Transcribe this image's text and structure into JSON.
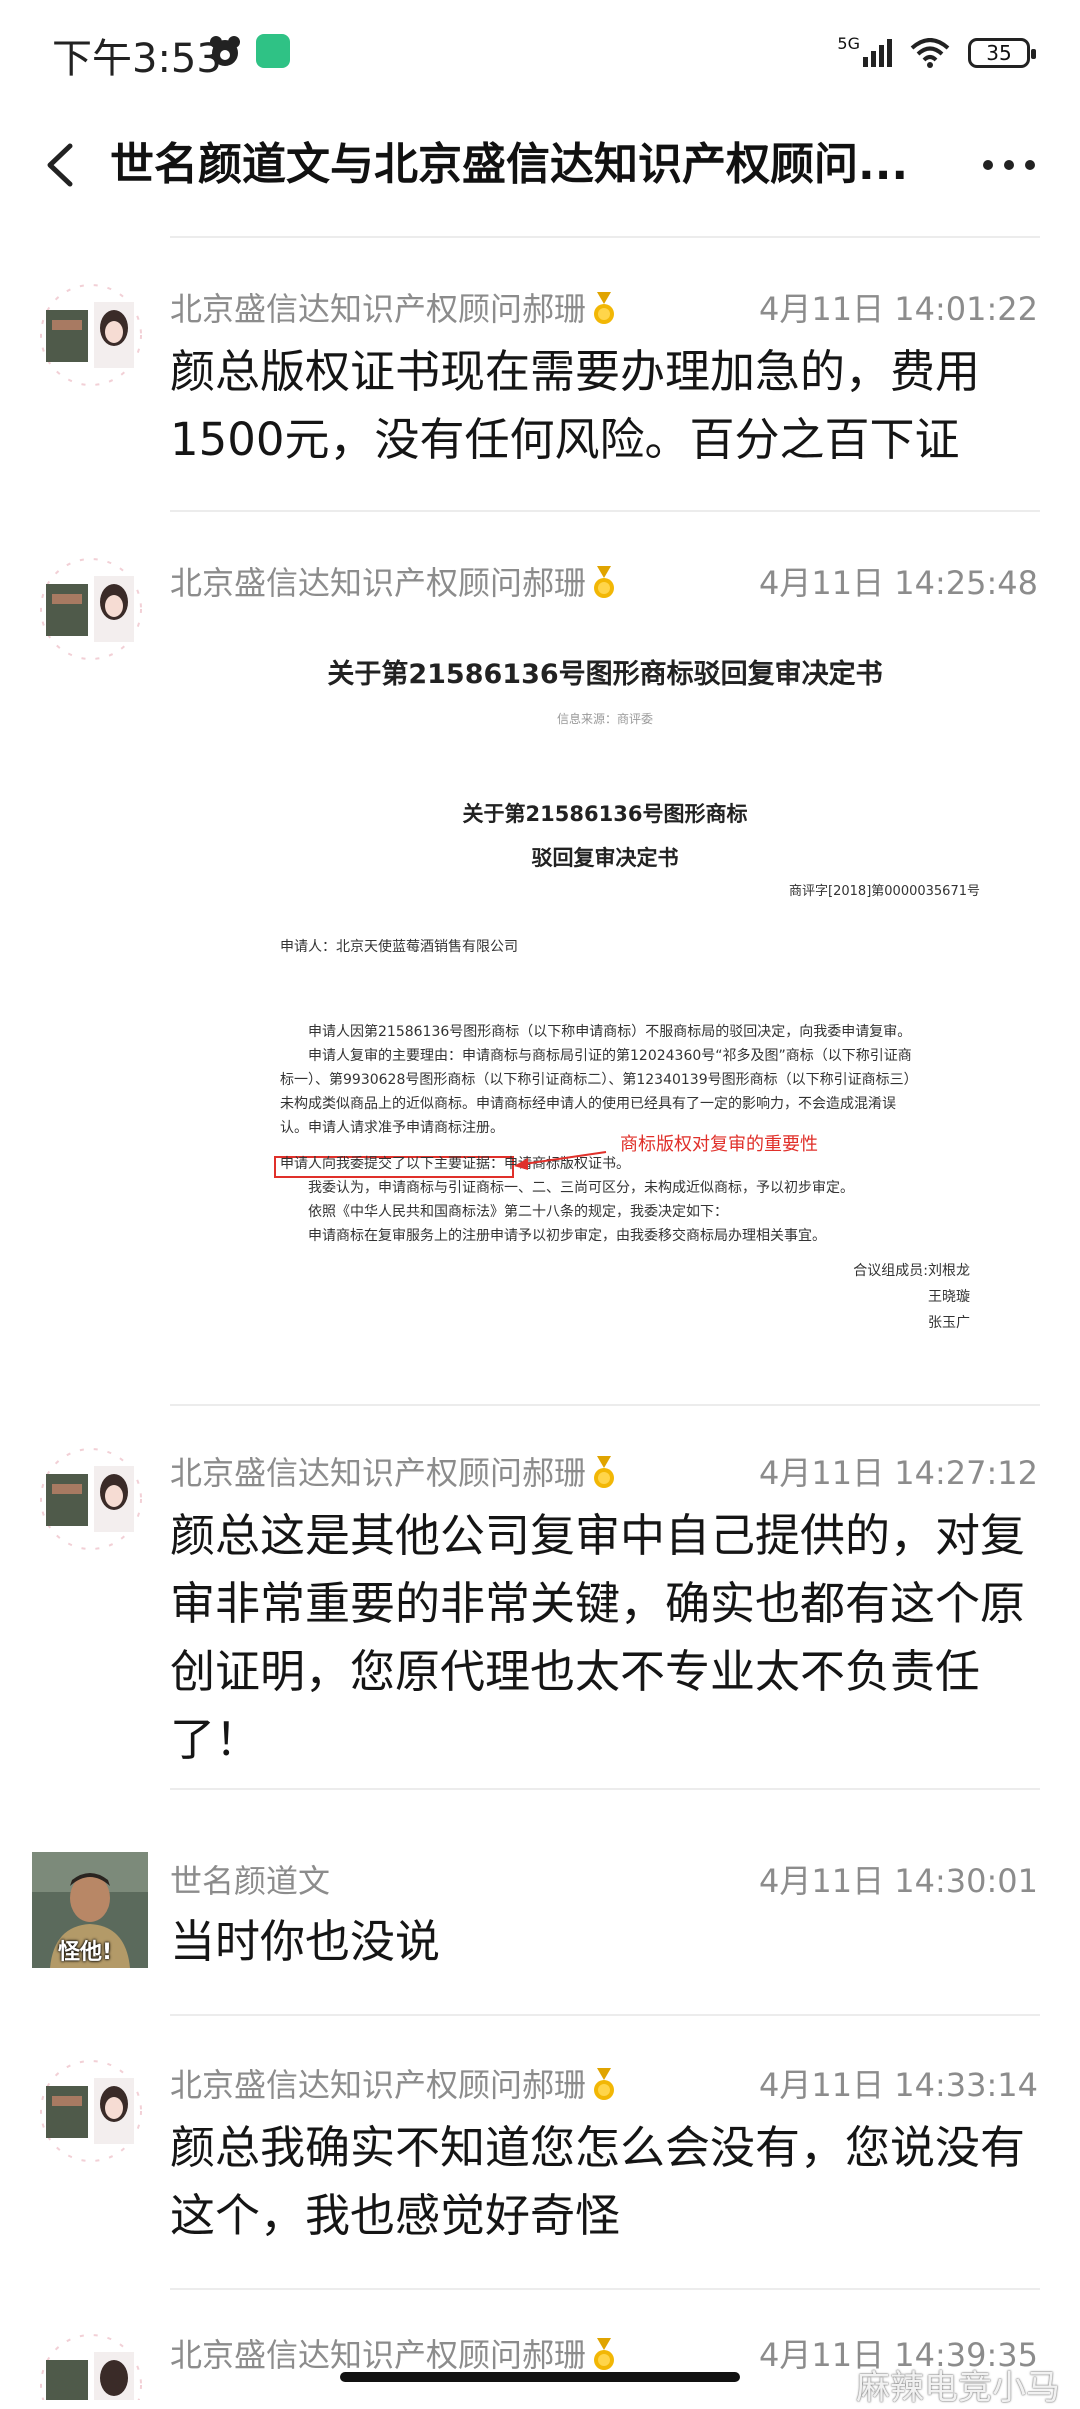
{
  "status_bar": {
    "time": "下午3:53",
    "network": "5G",
    "battery": "35"
  },
  "header": {
    "title": "世名颜道文与北京盛信达知识产权顾问..."
  },
  "messages": [
    {
      "sender": "北京盛信达知识产权顾问郝珊",
      "time": "4月11日 14:01:22",
      "text": "颜总版权证书现在需要办理加急的，费用1500元，没有任何风险。百分之百下证"
    },
    {
      "sender": "北京盛信达知识产权顾问郝珊",
      "time": "4月11日 14:25:48",
      "image": {
        "heading": "关于第21586136号图形商标驳回复审决定书",
        "source": "信息来源：商评委",
        "title_line1": "关于第21586136号图形商标",
        "title_line2": "驳回复审决定书",
        "ref": "商评字[2018]第0000035671号",
        "applicant": "申请人：北京天使蓝莓酒销售有限公司",
        "para1": "申请人因第21586136号图形商标（以下称申请商标）不服商标局的驳回决定，向我委申请复审。",
        "para2": "申请人复审的主要理由：申请商标与商标局引证的第12024360号“祁多及图”商标（以下称引证商标一）、第9930628号图形商标（以下称引证商标二）、第12340139号图形商标（以下称引证商标三）未构成类似商品上的近似商标。申请商标经申请人的使用已经具有了一定的影响力，不会造成混淆误认。申请人请求准予申请商标注册。",
        "para3": "申请人向我委提交了以下主要证据：申请商标版权证书。",
        "annotation": "商标版权对复审的重要性",
        "para4": "我委认为，申请商标与引证商标一、二、三尚可区分，未构成近似商标，予以初步审定。",
        "para5": "依照《中华人民共和国商标法》第二十八条的规定，我委决定如下：",
        "para6": "申请商标在复审服务上的注册申请予以初步审定，由我委移交商标局办理相关事宜。",
        "sign1": "合议组成员:刘根龙",
        "sign2": "王晓璇",
        "sign3": "张玉广"
      }
    },
    {
      "sender": "北京盛信达知识产权顾问郝珊",
      "time": "4月11日 14:27:12",
      "text": "颜总这是其他公司复审中自己提供的，对复审非常重要的非常关键，确实也都有这个原创证明，您原代理也太不专业太不负责任了！"
    },
    {
      "sender": "世名颜道文",
      "time": "4月11日 14:30:01",
      "text": "当时你也没说",
      "avatar_caption": "怪他!"
    },
    {
      "sender": "北京盛信达知识产权顾问郝珊",
      "time": "4月11日 14:33:14",
      "text": "颜总我确实不知道您怎么会没有，您说没有这个，我也感觉好奇怪"
    },
    {
      "sender": "北京盛信达知识产权顾问郝珊",
      "time": "4月11日 14:39:35"
    }
  ],
  "watermark": "麻辣电竞小马",
  "colors": {
    "name_gray": "#8c8c8c",
    "annotation_red": "#e0302a",
    "app_icon_green": "#2fc285"
  }
}
